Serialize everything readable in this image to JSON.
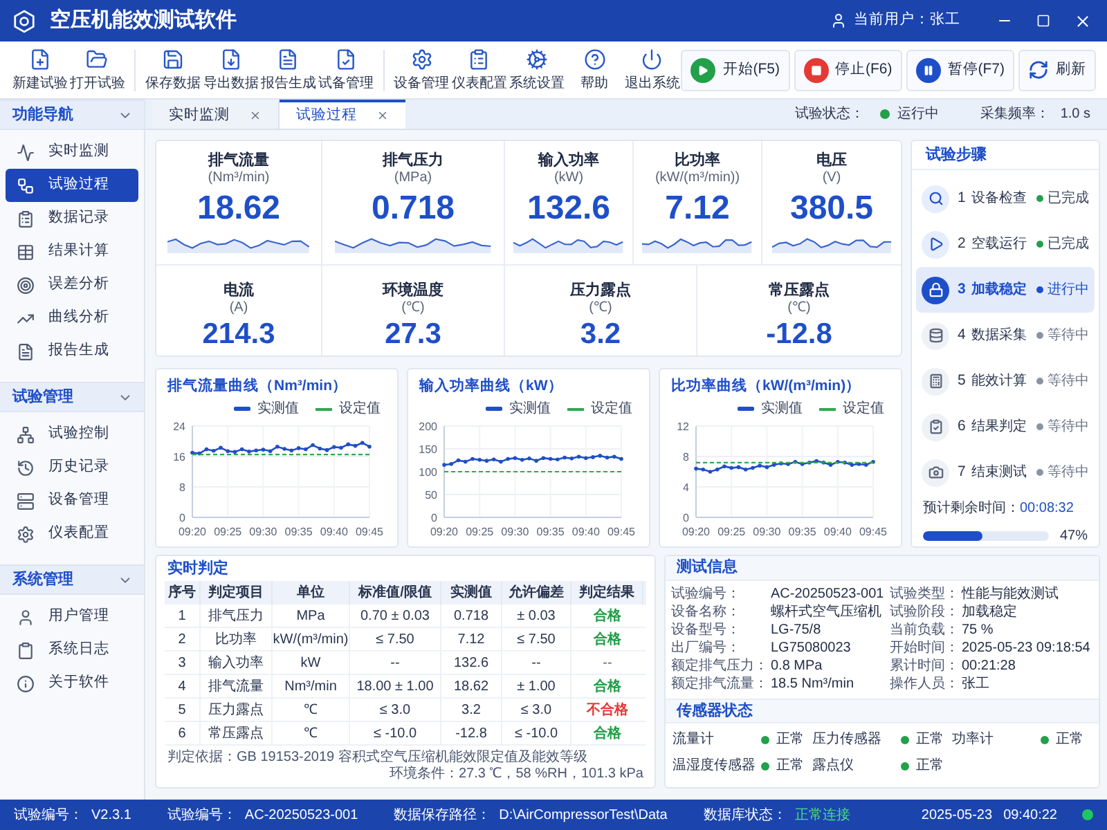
{
  "window": {
    "title": "空压机能效测试软件",
    "user": "当前用户：张工"
  },
  "toolbar": {
    "groups": [
      {
        "buttons": [
          "新建试验",
          "打开试验"
        ]
      },
      {
        "buttons": [
          "保存数据",
          "导出数据",
          "报告生成",
          "试备管理"
        ]
      },
      {
        "buttons": [
          "设备管理",
          "仪表配置",
          "系统设置",
          "帮助",
          "退出系统"
        ]
      }
    ],
    "actions": [
      {
        "kind": "start",
        "label": "开始(F5)"
      },
      {
        "kind": "stop",
        "label": "停止(F6)"
      },
      {
        "kind": "pause",
        "label": "暂停(F7)"
      },
      {
        "kind": "refresh",
        "label": "刷新"
      }
    ]
  },
  "sidebar": {
    "groups": [
      {
        "title": "功能导航",
        "expanded": true,
        "items": [
          {
            "label": "实时监测",
            "selected": false
          },
          {
            "label": "试验过程",
            "selected": true
          },
          {
            "label": "数据记录",
            "selected": false
          },
          {
            "label": "结果计算",
            "selected": false
          },
          {
            "label": "误差分析",
            "selected": false
          },
          {
            "label": "曲线分析",
            "selected": false
          },
          {
            "label": "报告生成",
            "selected": false
          }
        ]
      },
      {
        "title": "试验管理",
        "expanded": true,
        "items": [
          {
            "label": "试验控制",
            "selected": false
          },
          {
            "label": "历史记录",
            "selected": false
          },
          {
            "label": "设备管理",
            "selected": false
          },
          {
            "label": "仪表配置",
            "selected": false
          }
        ]
      },
      {
        "title": "系统管理",
        "expanded": true,
        "items": [
          {
            "label": "用户管理",
            "selected": false
          },
          {
            "label": "系统日志",
            "selected": false
          },
          {
            "label": "关于软件",
            "selected": false
          }
        ]
      }
    ]
  },
  "tabs": [
    {
      "label": "实时监测",
      "selected": false
    },
    {
      "label": "试验过程",
      "selected": true
    }
  ],
  "run_status": {
    "label": "试验状态：",
    "value": "运行中",
    "ok": true
  },
  "sample_rate": {
    "label": "采集频率：",
    "value": "1.0 s"
  },
  "metrics": [
    {
      "kind": "trend",
      "cards": [
        {
          "label": "排气流量",
          "unit": "(Nm³/min)",
          "value": "18.62"
        },
        {
          "label": "排气压力",
          "unit": "(MPa)",
          "value": "0.718"
        },
        {
          "label": "输入功率",
          "unit": "(kW)",
          "value": "132.6"
        },
        {
          "label": "比功率",
          "unit": "(kW/(m³/min))",
          "value": "7.12"
        },
        {
          "label": "电压",
          "unit": "(V)",
          "value": "380.5"
        }
      ]
    },
    {
      "kind": "plain",
      "cards": [
        {
          "label": "电流",
          "unit": "(A)",
          "value": "214.3"
        },
        {
          "label": "环境温度",
          "unit": "(℃)",
          "value": "27.3"
        },
        {
          "label": "压力露点",
          "unit": "(℃)",
          "value": "3.2"
        },
        {
          "label": "常压露点",
          "unit": "(℃)",
          "value": "-12.8"
        }
      ]
    }
  ],
  "charts": [
    {
      "chart_data": {
        "type": "line",
        "title": "排气流量曲线（Nm³/min）",
        "grid": true,
        "legend": "top-right",
        "categories": [
          "09:20",
          null,
          null,
          null,
          null,
          "09:25",
          null,
          null,
          null,
          null,
          "09:30",
          null,
          null,
          null,
          null,
          "09:35",
          null,
          null,
          null,
          null,
          "09:40",
          null,
          null,
          null,
          null,
          "09:45"
        ],
        "ylim": [
          0,
          24
        ],
        "yticks": [
          0,
          8,
          16,
          24
        ],
        "series": [
          {
            "name": "实测值",
            "color": "#1f4fc6",
            "line_style": "solid",
            "values": [
              17.0,
              16.8,
              17.9,
              17.5,
              18.3,
              17.4,
              17.2,
              17.9,
              17.3,
              17.6,
              17.8,
              17.4,
              18.6,
              18.0,
              17.6,
              18.2,
              17.9,
              19.0,
              18.1,
              17.7,
              18.5,
              18.3,
              19.2,
              18.8,
              19.6,
              18.6
            ]
          },
          {
            "name": "设定值",
            "color": "#2fa84f",
            "line_style": "dashed",
            "values": [
              16.5,
              16.5,
              16.5,
              16.5,
              16.5,
              16.5,
              16.5,
              16.5,
              16.5,
              16.5,
              16.5,
              16.5,
              16.5,
              16.5,
              16.5,
              16.5,
              16.5,
              16.5,
              16.5,
              16.5,
              16.5,
              16.5,
              16.5,
              16.5,
              16.5,
              16.5
            ]
          }
        ]
      }
    },
    {
      "chart_data": {
        "type": "line",
        "title": "输入功率曲线（kW）",
        "grid": true,
        "legend": "top-right",
        "categories": [
          "09:20",
          null,
          null,
          null,
          null,
          "09:25",
          null,
          null,
          null,
          null,
          "09:30",
          null,
          null,
          null,
          null,
          "09:35",
          null,
          null,
          null,
          null,
          "09:40",
          null,
          null,
          null,
          null,
          "09:45"
        ],
        "ylim": [
          0,
          200
        ],
        "yticks": [
          0,
          50,
          100,
          150,
          200
        ],
        "series": [
          {
            "name": "实测值",
            "color": "#1f4fc6",
            "line_style": "solid",
            "values": [
              115,
              117,
              125,
              122,
              128,
              126,
              124,
              127,
              122,
              128,
              130,
              126,
              129,
              124,
              130,
              128,
              127,
              131,
              129,
              133,
              130,
              132,
              135,
              131,
              133,
              128
            ]
          },
          {
            "name": "设定值",
            "color": "#2fa84f",
            "line_style": "dashed",
            "values": [
              100,
              100,
              100,
              100,
              100,
              100,
              100,
              100,
              100,
              100,
              100,
              100,
              100,
              100,
              100,
              100,
              100,
              100,
              100,
              100,
              100,
              100,
              100,
              100,
              100,
              100
            ]
          }
        ]
      }
    },
    {
      "chart_data": {
        "type": "line",
        "title": "比功率曲线（kW/(m³/min)）",
        "grid": true,
        "legend": "top-right",
        "categories": [
          "09:20",
          null,
          null,
          null,
          null,
          "09:25",
          null,
          null,
          null,
          null,
          "09:30",
          null,
          null,
          null,
          null,
          "09:35",
          null,
          null,
          null,
          null,
          "09:40",
          null,
          null,
          null,
          null,
          "09:45"
        ],
        "ylim": [
          0,
          12
        ],
        "yticks": [
          0,
          4,
          8,
          12
        ],
        "series": [
          {
            "name": "实测值",
            "color": "#1f4fc6",
            "line_style": "solid",
            "values": [
              6.4,
              6.3,
              6.0,
              6.3,
              6.7,
              6.5,
              6.6,
              6.3,
              6.5,
              6.8,
              6.6,
              6.9,
              7.1,
              7.0,
              7.3,
              7.0,
              7.2,
              7.4,
              7.2,
              6.9,
              7.3,
              7.2,
              6.9,
              7.0,
              6.9,
              7.3
            ]
          },
          {
            "name": "设定值",
            "color": "#2fa84f",
            "line_style": "dashed",
            "values": [
              7.2,
              7.2,
              7.2,
              7.2,
              7.2,
              7.2,
              7.2,
              7.2,
              7.2,
              7.2,
              7.2,
              7.2,
              7.2,
              7.2,
              7.2,
              7.2,
              7.2,
              7.2,
              7.2,
              7.2,
              7.2,
              7.2,
              7.2,
              7.2,
              7.2,
              7.2
            ]
          }
        ]
      }
    }
  ],
  "steps": {
    "title": "试验步骤",
    "items": [
      {
        "kind": "done",
        "number": "1",
        "name": "设备检查",
        "status": "已完成",
        "selected": false
      },
      {
        "kind": "done",
        "number": "2",
        "name": "空载运行",
        "status": "已完成",
        "selected": false
      },
      {
        "kind": "active",
        "number": "3",
        "name": "加载稳定",
        "status": "进行中",
        "selected": true
      },
      {
        "kind": "waiting",
        "number": "4",
        "name": "数据采集",
        "status": "等待中",
        "selected": false
      },
      {
        "kind": "waiting",
        "number": "5",
        "name": "能效计算",
        "status": "等待中",
        "selected": false
      },
      {
        "kind": "waiting",
        "number": "6",
        "name": "结果判定",
        "status": "等待中",
        "selected": false
      },
      {
        "kind": "waiting",
        "number": "7",
        "name": "结束测试",
        "status": "等待中",
        "selected": false
      }
    ],
    "remaining": {
      "label": "预计剩余时间：",
      "value": "00:08:32"
    },
    "progress": {
      "level": 0.47,
      "reading": "47%"
    }
  },
  "judgment": {
    "title": "实时判定",
    "columns": [
      "序号",
      "判定项目",
      "单位",
      "标准值/限值",
      "实测值",
      "允许偏差",
      "判定结果"
    ],
    "rows": [
      {
        "kind": "pass",
        "cells": [
          "1",
          "排气压力",
          "MPa",
          "0.70 ± 0.03",
          "0.718",
          "± 0.03",
          "合格"
        ]
      },
      {
        "kind": "pass",
        "cells": [
          "2",
          "比功率",
          "kW/(m³/min)",
          "≤ 7.50",
          "7.12",
          "≤ 7.50",
          "合格"
        ]
      },
      {
        "kind": "none",
        "cells": [
          "3",
          "输入功率",
          "kW",
          "--",
          "132.6",
          "--",
          "--"
        ]
      },
      {
        "kind": "pass",
        "cells": [
          "4",
          "排气流量",
          "Nm³/min",
          "18.00 ± 1.00",
          "18.62",
          "± 1.00",
          "合格"
        ]
      },
      {
        "kind": "fail",
        "cells": [
          "5",
          "压力露点",
          "℃",
          "≤ 3.0",
          "3.2",
          "≤ 3.0",
          "不合格"
        ]
      },
      {
        "kind": "pass",
        "cells": [
          "6",
          "常压露点",
          "℃",
          "≤ -10.0",
          "-12.8",
          "≤ -10.0",
          "合格"
        ]
      }
    ],
    "basis": "判定依据：GB 19153-2019 容积式空气压缩机能效限定值及能效等级",
    "conditions": "环境条件：27.3 ℃，58 %RH，101.3 kPa"
  },
  "test_info": {
    "title": "测试信息",
    "columns": [
      [
        {
          "label": "试验编号：",
          "value": "AC-20250523-001"
        },
        {
          "label": "设备名称：",
          "value": "螺杆式空气压缩机"
        },
        {
          "label": "设备型号：",
          "value": "LG-75/8"
        },
        {
          "label": "出厂编号：",
          "value": "LG75080023"
        },
        {
          "label": "额定排气压力：",
          "value": "0.8 MPa"
        },
        {
          "label": "额定排气流量：",
          "value": "18.5 Nm³/min"
        }
      ],
      [
        {
          "label": "试验类型：",
          "value": "性能与能效测试"
        },
        {
          "label": "试验阶段：",
          "value": "加载稳定"
        },
        {
          "label": "当前负载：",
          "value": "75 %"
        },
        {
          "label": "开始时间：",
          "value": "2025-05-23 09:18:54"
        },
        {
          "label": "累计时间：",
          "value": "00:21:28"
        },
        {
          "label": "操作人员：",
          "value": "张工"
        }
      ]
    ]
  },
  "sensors": {
    "title": "传感器状态",
    "items": [
      {
        "name": "流量计",
        "status": "正常",
        "ok": true
      },
      {
        "name": "压力传感器",
        "status": "正常",
        "ok": true
      },
      {
        "name": "功率计",
        "status": "正常",
        "ok": true
      },
      {
        "name": "温湿度传感器",
        "status": "正常",
        "ok": true
      },
      {
        "name": "露点仪",
        "status": "正常",
        "ok": true
      }
    ]
  },
  "status_bar": {
    "items": [
      {
        "label": "试验编号：",
        "value": "V2.3.1"
      },
      {
        "label": "试验编号：",
        "value": "AC-20250523-001"
      },
      {
        "label": "数据保存路径：",
        "value": "D:\\AirCompressorTest\\Data"
      }
    ],
    "database": {
      "label": "数据库状态：",
      "value": "正常连接",
      "connected": true
    },
    "date": "2025-05-23",
    "time": "09:40:22",
    "online": true
  }
}
